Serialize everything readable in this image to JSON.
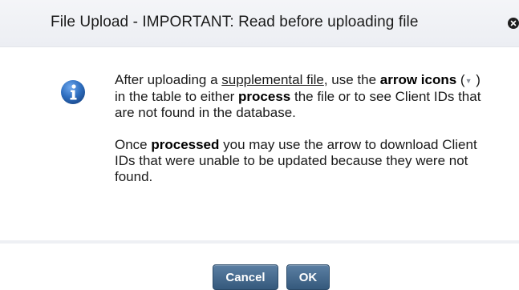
{
  "dialog": {
    "title": "File Upload - IMPORTANT: Read before uploading file"
  },
  "message": {
    "p1_before_link": "After uploading a ",
    "p1_link": "supplemental file",
    "p1_after_link": ", use the ",
    "p1_bold_arrow": "arrow icons",
    "p1_open_paren": " (",
    "p1_arrow_glyph": "▼",
    "p1_close_paren": " ) in the table to either ",
    "p1_bold_process": "process",
    "p1_rest": " the file or to see Client IDs that are not found in the database.",
    "p2_before_bold": "Once ",
    "p2_bold_processed": "processed",
    "p2_rest": " you may use the arrow to download Client IDs that were unable to be updated because they were not found."
  },
  "buttons": {
    "cancel_label": "Cancel",
    "ok_label": "OK"
  },
  "icons": {
    "info": "info-icon",
    "close": "close-icon"
  },
  "colors": {
    "button_accent": "#3d6187",
    "info_icon": "#2f6fc0"
  }
}
